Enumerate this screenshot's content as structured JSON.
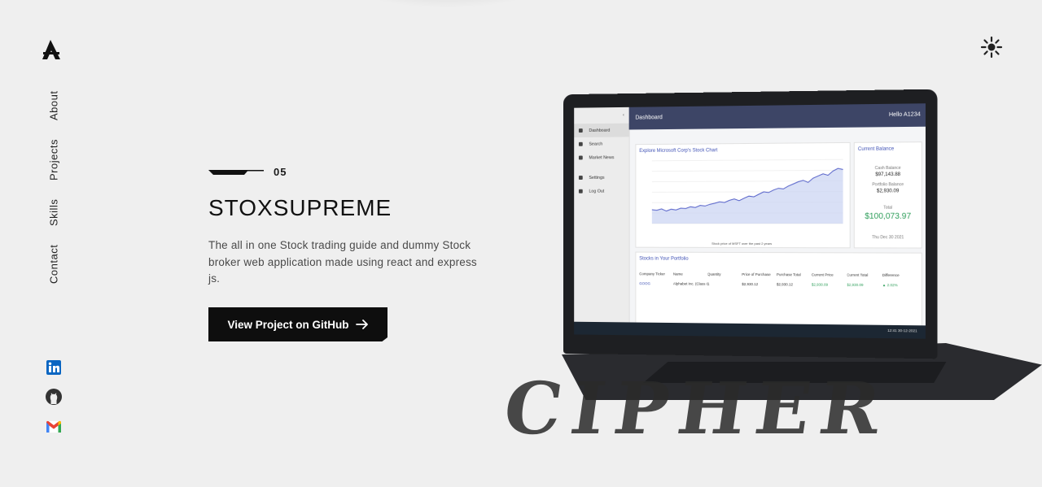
{
  "nav": {
    "items": [
      "About",
      "Projects",
      "Skills",
      "Contact"
    ]
  },
  "social": {
    "linkedin_icon": "linkedin-icon",
    "github_icon": "github-icon",
    "gmail_icon": "gmail-icon"
  },
  "project": {
    "number": "05",
    "title": "STOXSUPREME",
    "description": "The all in one Stock trading guide and dummy Stock broker web application made using react and express js.",
    "button_label": "View Project on GitHub",
    "button_icon": "arrow-right-icon"
  },
  "overlay_text": "CIPHER",
  "dashboard": {
    "top_title": "Dashboard",
    "user": "Hello A1234",
    "menu": [
      "Dashboard",
      "Search",
      "Market News",
      "Settings",
      "Log Out"
    ],
    "chart_title": "Explore Microsoft Corp's Stock Chart",
    "chart_caption": "Stock price of MSFT over the past 2 years",
    "balance_title": "Current Balance",
    "cash_label": "Cash Balance",
    "cash_value": "$97,143.88",
    "portfolio_label": "Portfolio Balance",
    "portfolio_value": "$2,930.09",
    "total_label": "Total",
    "total_value": "$100,073.97",
    "date": "Thu Dec 30 2021",
    "portfolio_title": "Stocks in Your Portfolio",
    "table_headers": [
      "Company Ticker",
      "Name",
      "Quantity",
      "Price of Purchase",
      "Purchase Total",
      "Current Price",
      "Current Total",
      "Difference"
    ],
    "table_row": [
      "GOOG",
      "Alphabet Inc. (Class C)",
      "1",
      "$2,930.12",
      "$2,930.12",
      "$2,930.09",
      "$2,930.09",
      "▲ 2.02%"
    ],
    "taskbar_clock": "12:41 30-12-2021",
    "chart_points": [
      240,
      238,
      242,
      236,
      241,
      239,
      244,
      243,
      248,
      246,
      252,
      250,
      255,
      258,
      262,
      260,
      266,
      270,
      265,
      272,
      278,
      276,
      283,
      290,
      288,
      295,
      300,
      298,
      306,
      312,
      318,
      322,
      316,
      328,
      334,
      340,
      336,
      348,
      355,
      352
    ]
  },
  "colors": {
    "background": "#efefef",
    "button_bg": "#0e0e0e",
    "accent_blue": "#3f51b5",
    "positive_green": "#2e9e5a"
  }
}
